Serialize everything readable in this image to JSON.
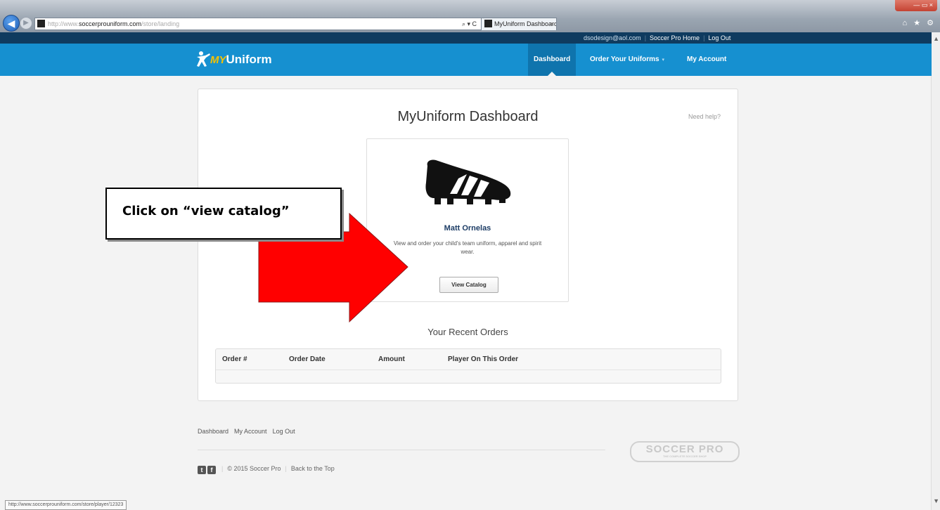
{
  "browser": {
    "url_prefix": "http://www.",
    "url_domain": "soccerprouniform.com",
    "url_path": "/store/landing",
    "address_controls": "⌕ ▾ C",
    "tab_title": "MyUniform Dashboard - So...",
    "tab_close": "×",
    "window_controls": "— ▭ ×",
    "toolbar_icons": "⌂ ★ ⚙"
  },
  "topbar": {
    "email": "dsodesign@aol.com",
    "home": "Soccer Pro Home",
    "logout": "Log Out"
  },
  "nav": {
    "logo_my": "MY",
    "logo_uniform": "Uniform",
    "dashboard": "Dashboard",
    "order": "Order Your Uniforms",
    "order_caret": "▾",
    "account": "My Account"
  },
  "main": {
    "title": "MyUniform Dashboard",
    "help": "Need help?",
    "player_name": "Matt Ornelas",
    "player_desc": "View and order your child's team uniform, apparel and spirit wear.",
    "view_button": "View Catalog",
    "recent_title": "Your Recent Orders",
    "orders_columns": [
      "Order #",
      "Order Date",
      "Amount",
      "Player On This Order"
    ]
  },
  "footer": {
    "links": [
      "Dashboard",
      "My Account",
      "Log Out"
    ],
    "copyright": "© 2015 Soccer Pro",
    "back_top": "Back to the Top",
    "brand": "SOCCER PRO",
    "brand_tagline": "THE COMPLETE SOCCER SHOP"
  },
  "status_url": "http://www.soccerprouniform.com/store/player/12323",
  "annotation": {
    "text": "Click on “view catalog”",
    "arrow_color": "#ff0000"
  }
}
